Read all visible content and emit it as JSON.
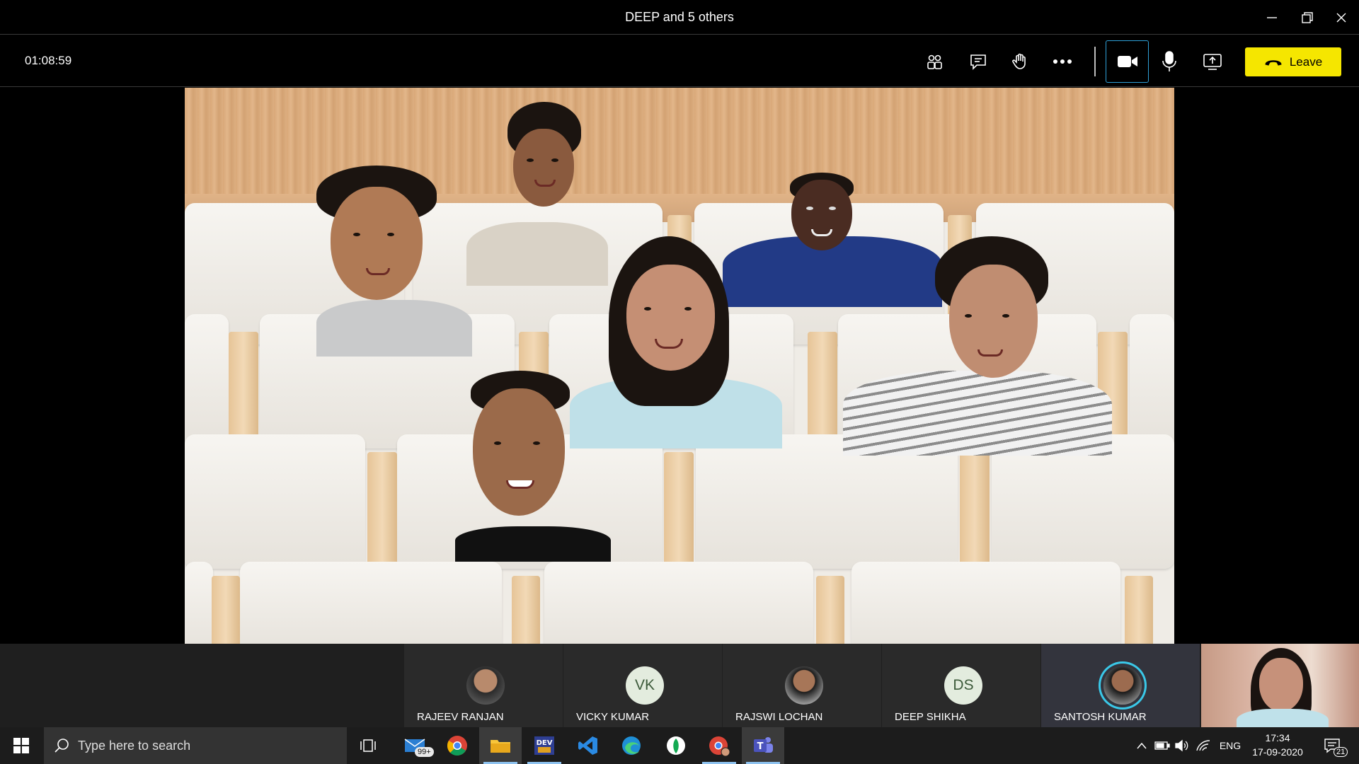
{
  "window": {
    "title": "DEEP and 5 others",
    "controls": [
      "minimize-icon",
      "restore-icon",
      "close-icon"
    ]
  },
  "meeting": {
    "timer": "01:08:59",
    "toolbar": {
      "icons": [
        "participants-icon",
        "chat-icon",
        "raise-hand-icon",
        "more-options-icon",
        "camera-icon",
        "microphone-icon",
        "share-screen-icon"
      ],
      "leave_label": "Leave",
      "leave_color": "#f5e600",
      "camera_active_border": "#2fa0d8"
    },
    "view_mode": "together-mode-auditorium"
  },
  "participants": [
    {
      "name": "RAJEEV RANJAN",
      "avatar": "photo"
    },
    {
      "name": "VICKY KUMAR",
      "avatar": "initials",
      "initials": "VK"
    },
    {
      "name": "RAJSWI LOCHAN",
      "avatar": "photo"
    },
    {
      "name": "DEEP SHIKHA",
      "avatar": "initials",
      "initials": "DS"
    },
    {
      "name": "SANTOSH KUMAR",
      "avatar": "photo",
      "speaking": true,
      "ring_color": "#3ac8e8"
    }
  ],
  "taskbar": {
    "search_placeholder": "Type here to search",
    "apps": [
      "task-view-icon",
      "mail-icon",
      "chrome-icon",
      "file-explorer-icon",
      "dev-cpp-icon",
      "vscode-icon",
      "edge-icon",
      "mongodb-compass-icon",
      "chrome-profile-icon",
      "teams-icon"
    ],
    "mail_badge": "99+",
    "tray": {
      "language": "ENG",
      "time": "17:34",
      "date": "17-09-2020",
      "notification_count": "21"
    }
  }
}
